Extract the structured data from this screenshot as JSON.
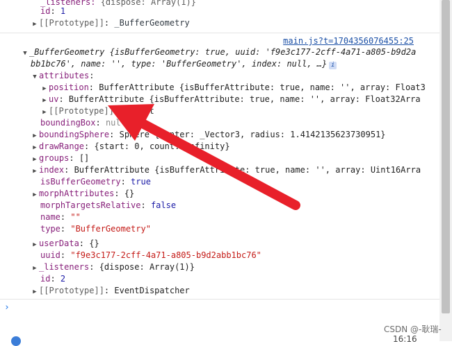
{
  "source_link": "main.js?t=1704356076455:25",
  "lines": [
    {
      "text1": "_listeners: ",
      "text2": "{dispose: Array(1)}"
    },
    {
      "key": "id",
      "value": "1"
    },
    {
      "key": "[[Prototype]]",
      "value": "_BufferGeometry"
    },
    {
      "header_class": "_BufferGeometry",
      "header_preview": "{isBufferGeometry: true, uuid: 'f9e3c177-2cff-4a71-a805-b9d2a",
      "header_cont": "bb1bc76', name: '', type: 'BufferGeometry', index: null, …}"
    },
    {
      "key": "attributes"
    },
    {
      "key": "position",
      "value": "BufferAttribute {isBufferAttribute: true, name: '', array: Float3"
    },
    {
      "key": "uv",
      "value": "BufferAttribute {isBufferAttribute: true, name: '', array: Float32Arra"
    },
    {
      "key": "[[Prototype]]",
      "value": "Object"
    },
    {
      "key": "boundingBox",
      "value": "null"
    },
    {
      "key": "boundingSphere",
      "value": "Sphere {center: _Vector3, radius: 1.4142135623730951}"
    },
    {
      "key": "drawRange",
      "value": "{start: 0, count: Infinity}"
    },
    {
      "key": "groups",
      "value": "[]"
    },
    {
      "key": "index",
      "value": "BufferAttribute {isBufferAttribute: true, name: '', array: Uint16Arra"
    },
    {
      "key": "isBufferGeometry",
      "value": "true"
    },
    {
      "key": "morphAttributes",
      "value": "{}"
    },
    {
      "key": "morphTargetsRelative",
      "value": "false"
    },
    {
      "key": "name",
      "value": "\"\""
    },
    {
      "key": "type",
      "value": "\"BufferGeometry\""
    },
    {
      "key": "userData",
      "value": "{}"
    },
    {
      "key": "uuid",
      "value": "\"f9e3c177-2cff-4a71-a805-b9d2abb1bc76\""
    },
    {
      "key": "_listeners",
      "value": "{dispose: Array(1)}"
    },
    {
      "key": "id",
      "value": "2"
    },
    {
      "key": "[[Prototype]]",
      "value": "EventDispatcher"
    }
  ],
  "prompt_symbol": "›",
  "watermark": "CSDN @-耿瑞-",
  "watermark_clock": "16:16",
  "colors": {
    "arrow": "#e8202a",
    "link": "#1a4fa6",
    "key": "#871f7a",
    "string": "#c41a16",
    "number": "#1a1aa6"
  }
}
